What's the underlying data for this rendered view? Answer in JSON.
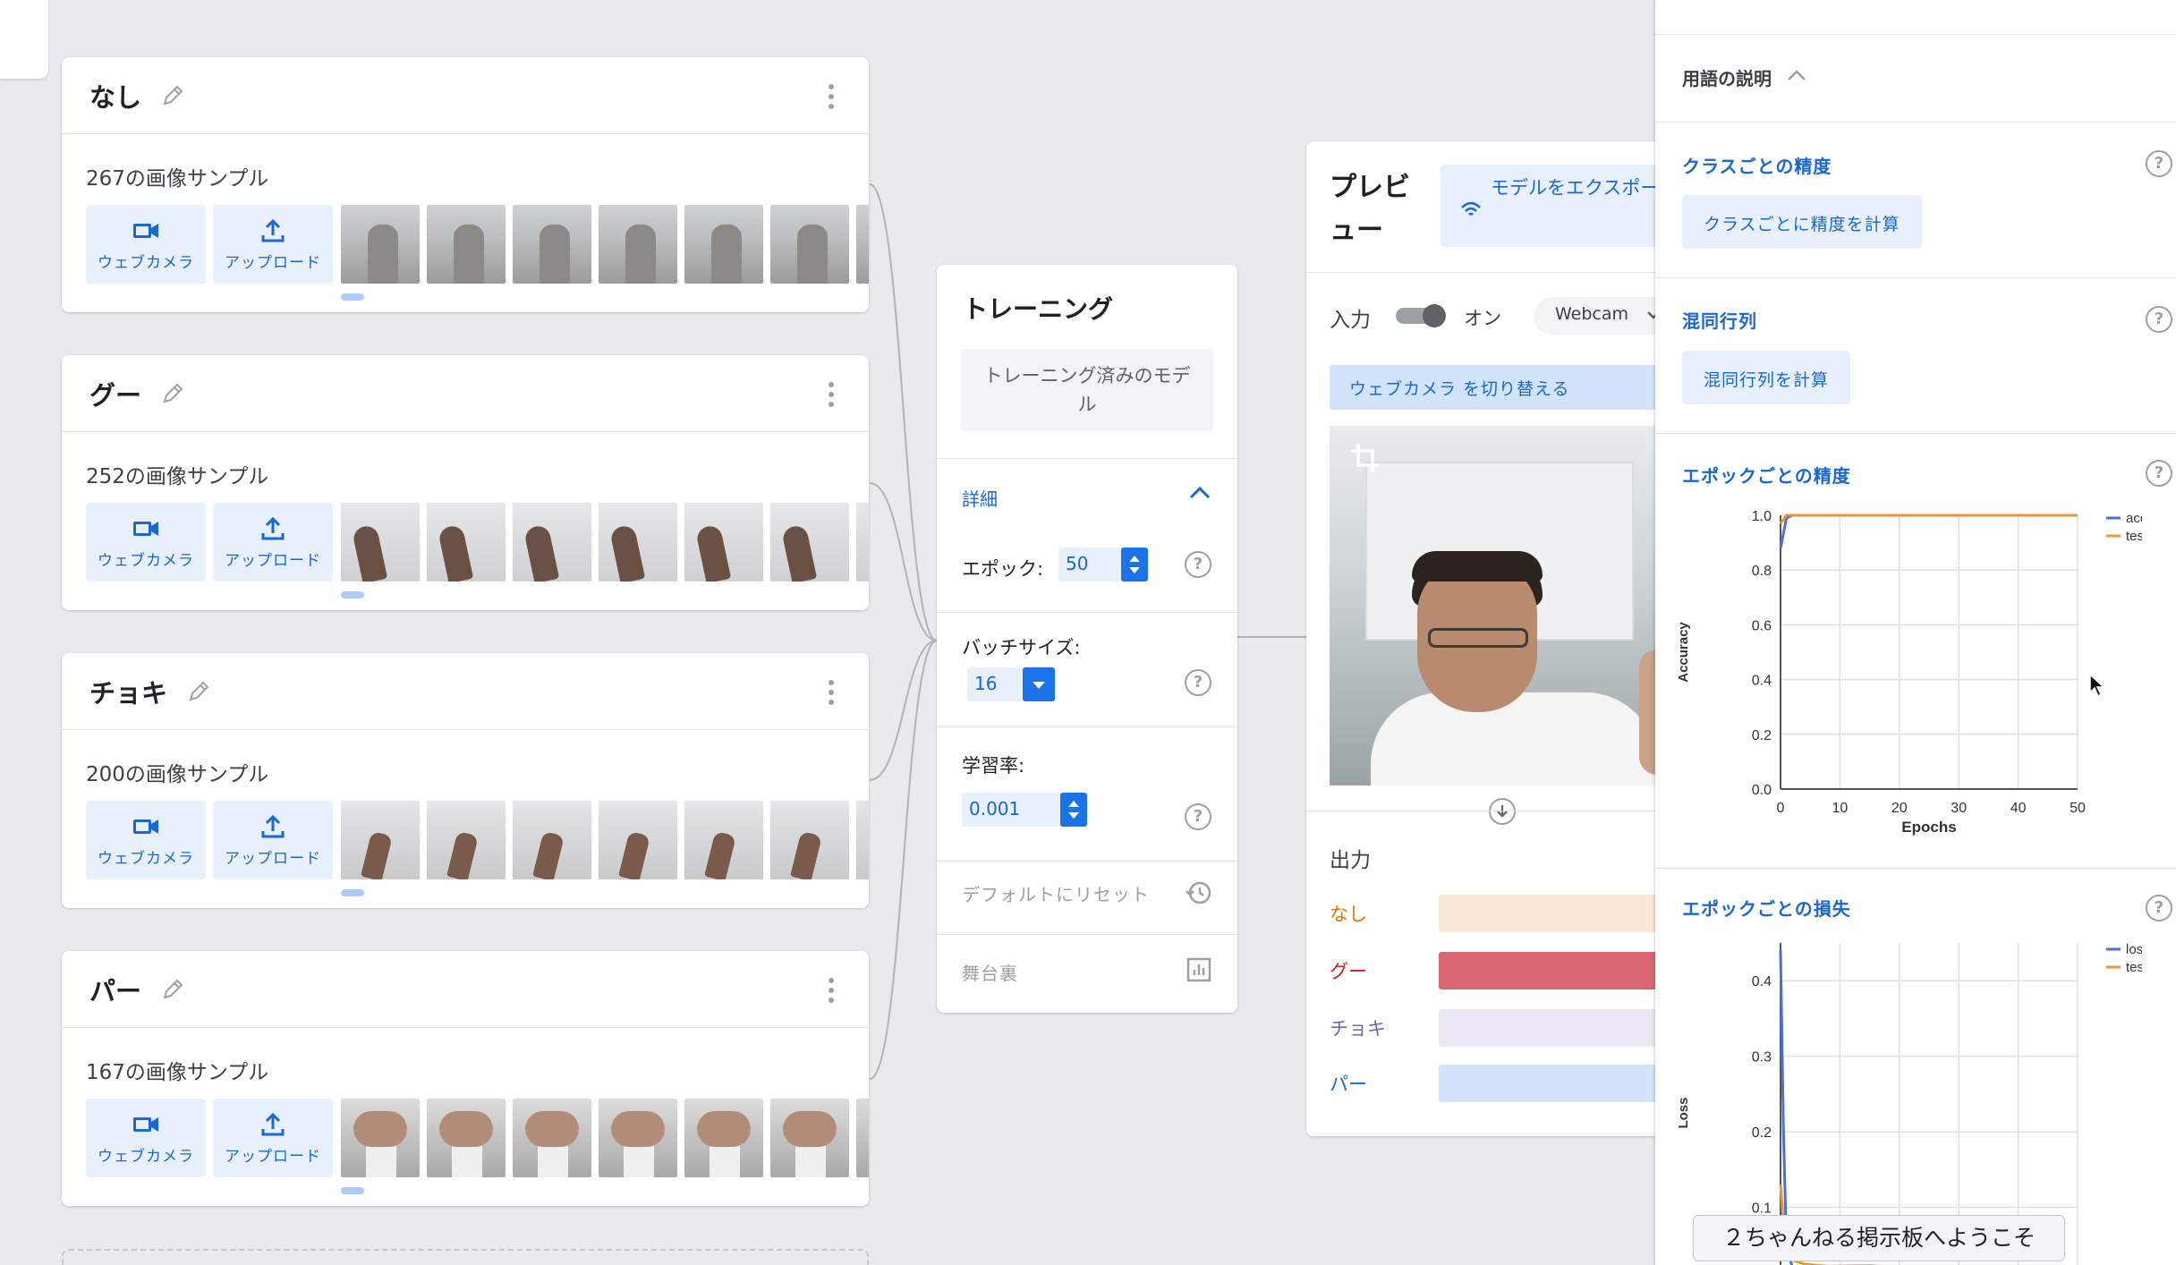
{
  "classes": [
    {
      "name": "なし",
      "samples": "267の画像サンプル",
      "thumb": "none"
    },
    {
      "name": "グー",
      "samples": "252の画像サンプル",
      "thumb": "rock"
    },
    {
      "name": "チョキ",
      "samples": "200の画像サンプル",
      "thumb": "scissors"
    },
    {
      "name": "パー",
      "samples": "167の画像サンプル",
      "thumb": "paper"
    }
  ],
  "class_buttons": {
    "webcam": "ウェブカメラ",
    "upload": "アップロード"
  },
  "training": {
    "title": "トレーニング",
    "trained_button": "トレーニング済みのモデル",
    "advanced": "詳細",
    "epochs_label": "エポック:",
    "epochs_value": "50",
    "batch_label": "バッチサイズ:",
    "batch_value": "16",
    "lr_label": "学習率:",
    "lr_value": "0.001",
    "reset": "デフォルトにリセット",
    "under_hood": "舞台裏"
  },
  "preview": {
    "title": "プレビュー",
    "export": "モデルをエクスポートする",
    "input_label": "入力",
    "toggle_state": "オン",
    "source": "Webcam",
    "switch_camera": "ウェブカメラ を切り替える",
    "output_label": "出力",
    "outputs": [
      {
        "label": "なし",
        "color": "#e37400",
        "bg": "#fce8d6",
        "value": 0
      },
      {
        "label": "グー",
        "color": "#c5221f",
        "bg": "#d96570",
        "value": 1.0,
        "pct": "10"
      },
      {
        "label": "チョキ",
        "color": "#7b61ad",
        "bg": "#ece8f6",
        "value": 0
      },
      {
        "label": "パー",
        "color": "#1967d2",
        "bg": "#d2e3fc",
        "value": 0
      }
    ]
  },
  "side_panel": {
    "glossary": "用語の説明",
    "per_class_title": "クラスごとの精度",
    "per_class_button": "クラスごとに精度を計算",
    "confusion_title": "混同行列",
    "confusion_button": "混同行列を計算",
    "acc_title": "エポックごとの精度",
    "loss_title": "エポックごとの損失"
  },
  "caption": "２ちゃんねる掲示板へようこそ",
  "chart_data": [
    {
      "type": "line",
      "title": "エポックごとの精度",
      "xlabel": "Epochs",
      "ylabel": "Accuracy",
      "xlim": [
        0,
        50
      ],
      "ylim": [
        0,
        1.0
      ],
      "xticks": [
        "0",
        "10",
        "20",
        "30",
        "40",
        "50"
      ],
      "yticks": [
        "0.0",
        "0.2",
        "0.4",
        "0.6",
        "0.8",
        "1.0"
      ],
      "legend": "top-right",
      "series": [
        {
          "name": "acc",
          "color": "#4c6fd8",
          "x": [
            0,
            1,
            2,
            5,
            10,
            20,
            30,
            40,
            50
          ],
          "y": [
            0.88,
            0.99,
            1.0,
            1.0,
            1.0,
            1.0,
            1.0,
            1.0,
            1.0
          ]
        },
        {
          "name": "test acc",
          "color": "#e8963a",
          "x": [
            0,
            1,
            2,
            5,
            10,
            20,
            30,
            40,
            50
          ],
          "y": [
            0.97,
            1.0,
            1.0,
            1.0,
            1.0,
            1.0,
            1.0,
            1.0,
            1.0
          ]
        }
      ]
    },
    {
      "type": "line",
      "title": "エポックごとの損失",
      "xlabel": "",
      "ylabel": "Loss",
      "xlim": [
        0,
        50
      ],
      "ylim": [
        0,
        0.45
      ],
      "yticks": [
        "0.1",
        "0.2",
        "0.3",
        "0.4"
      ],
      "legend": "top-right",
      "series": [
        {
          "name": "loss",
          "color": "#4c6fd8",
          "x": [
            0,
            0.5,
            1,
            2,
            4,
            8,
            15,
            25,
            35,
            50
          ],
          "y": [
            0.44,
            0.2,
            0.05,
            0.02,
            0.01,
            0.005,
            0.003,
            0.002,
            0.002,
            0.001
          ]
        },
        {
          "name": "test loss",
          "color": "#e8963a",
          "x": [
            0,
            0.5,
            1,
            2,
            4,
            8,
            15,
            20,
            25,
            30,
            35,
            50
          ],
          "y": [
            0.13,
            0.08,
            0.04,
            0.03,
            0.025,
            0.022,
            0.023,
            0.02,
            0.012,
            0.006,
            0.004,
            0.002
          ]
        }
      ]
    }
  ]
}
